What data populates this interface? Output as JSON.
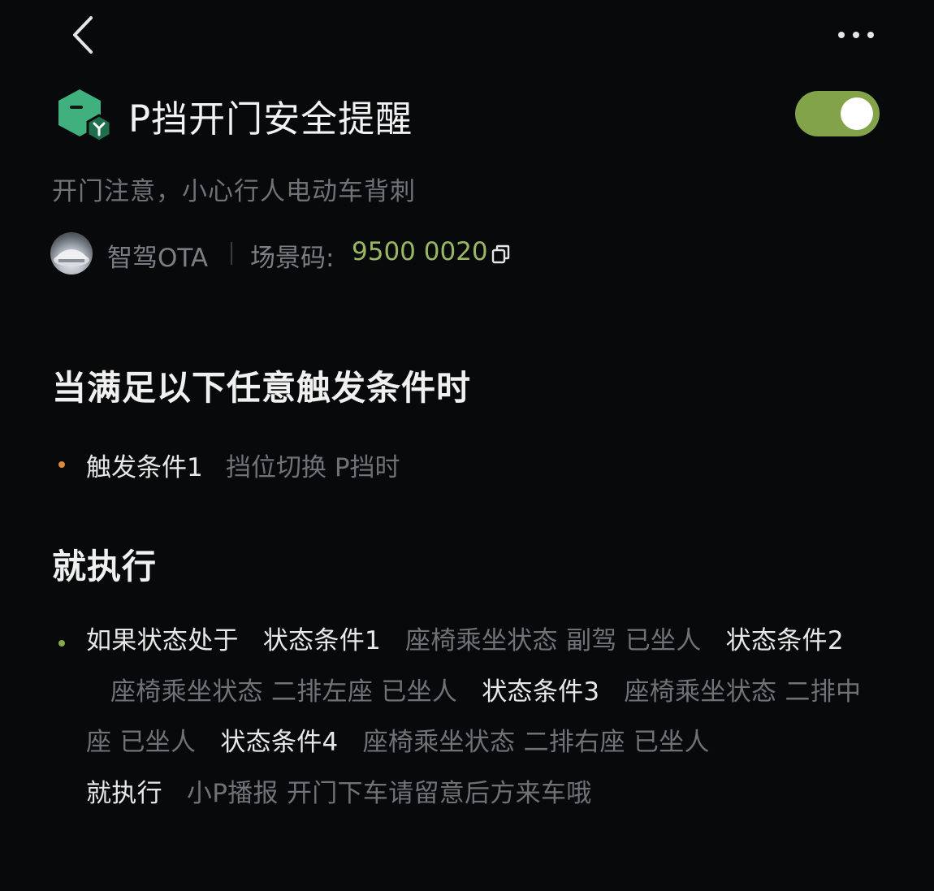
{
  "scene": {
    "title": "P挡开门安全提醒",
    "subtitle": "开门注意，小心行人电动车背刺",
    "enabled": true,
    "author": "智驾OTA",
    "code_label": "场景码:",
    "code_value": "9500 0020"
  },
  "trigger_section": {
    "heading": "当满足以下任意触发条件时",
    "triggers": [
      {
        "label": "触发条件1",
        "description": "挡位切换 P挡时"
      }
    ]
  },
  "action_section": {
    "heading": "就执行",
    "if_label": "如果状态处于",
    "conditions": [
      {
        "label": "状态条件1",
        "description": "座椅乘坐状态 副驾 已坐人"
      },
      {
        "label": "状态条件2",
        "description": "座椅乘坐状态 二排左座 已坐人"
      },
      {
        "label": "状态条件3",
        "description": "座椅乘坐状态 二排中座 已坐人"
      },
      {
        "label": "状态条件4",
        "description": "座椅乘坐状态 二排右座 已坐人"
      }
    ],
    "then_label": "就执行",
    "then_description": "小P播报 开门下车请留意后方来车哦"
  },
  "colors": {
    "accent_green": "#82a34a",
    "code_green": "#9ab763",
    "trigger_bullet": "#d98a3a",
    "action_bullet": "#8aa94f"
  },
  "icons": {
    "back": "chevron-left-icon",
    "more": "more-dots-icon",
    "scene": "scene-hexagon-icon",
    "copy": "copy-icon"
  }
}
